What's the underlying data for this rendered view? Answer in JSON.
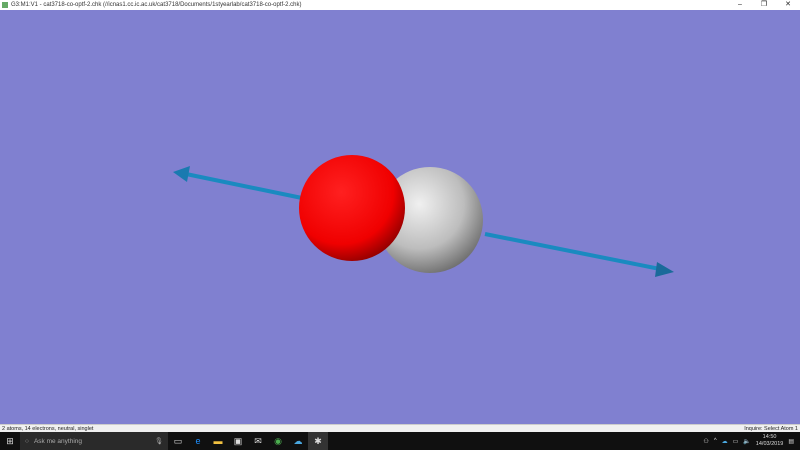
{
  "window": {
    "title": "G3:M1:V1 - cat3718-co-optf-2.chk (//icnas1.cc.ic.ac.uk/cat3718/Documents/1styearlab/cat3718-co-optf-2.chk)",
    "minimize": "–",
    "maximize": "❐",
    "close": "✕"
  },
  "viewer": {
    "background": "#8080d0",
    "atoms": [
      {
        "element": "O",
        "color": "#ff0000"
      },
      {
        "element": "C",
        "color": "#c8c8c8"
      }
    ],
    "arrow_color": "#1a8ac0"
  },
  "status": {
    "left": "2 atoms, 14 electrons, neutral, singlet",
    "right": "Inquire: Select Atom 1"
  },
  "taskbar": {
    "search_placeholder": "Ask me anything",
    "time": "14:50",
    "date": "14/03/2019"
  }
}
